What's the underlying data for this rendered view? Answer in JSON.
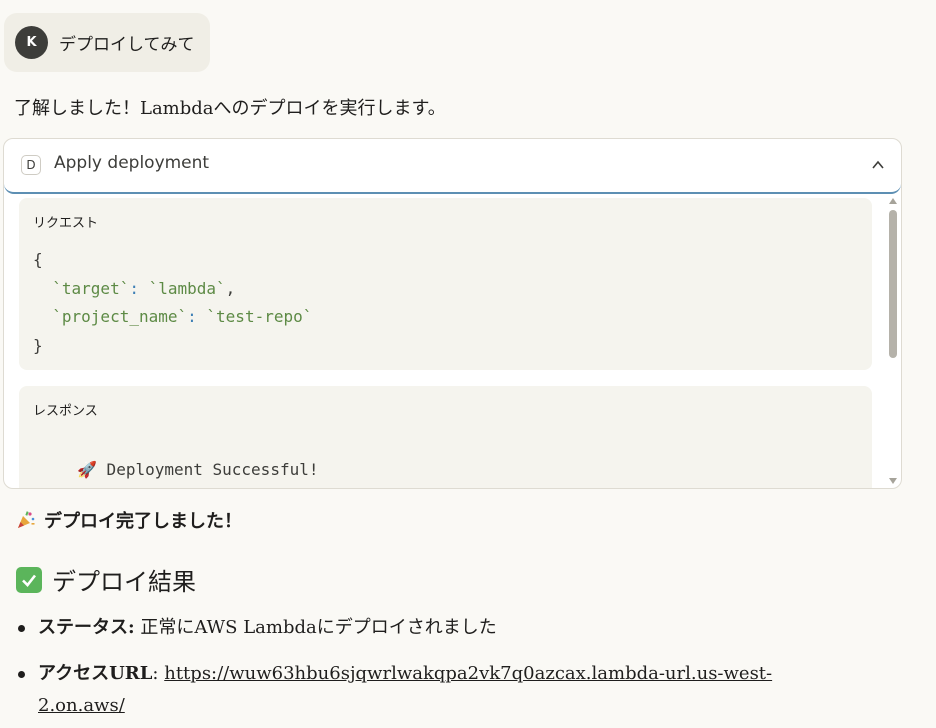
{
  "user_message": {
    "avatar_initial": "K",
    "text": "デプロイしてみて"
  },
  "assistant": {
    "intro": "了解しました！Lambdaへのデプロイを実行します。",
    "tool_call": {
      "icon_letter": "D",
      "title": "Apply deployment",
      "request_label": "リクエスト",
      "request_code": {
        "open": "{",
        "line1_key": "`target`",
        "line1_colon": ":",
        "line1_value": "`lambda`",
        "line1_comma": ",",
        "line2_key": "`project_name`",
        "line2_colon": ":",
        "line2_value": "`test-repo`",
        "close": "}"
      },
      "response_label": "レスポンス",
      "response_text": "🚀 Deployment Successful!"
    },
    "done_text": "デプロイ完了しました！",
    "result_heading": "デプロイ結果",
    "results": [
      {
        "key": "ステータス",
        "sep": ":",
        "value": " 正常にAWS Lambdaにデプロイされました"
      },
      {
        "key": "アクセスURL",
        "sep": ":",
        "url_line1": "https://wuw63hbu6sjqwrlwakqpa2vk7q0azcax.lambda-url.us-west-",
        "url_line2": "2.on.aws/"
      }
    ]
  },
  "colors": {
    "background": "#faf9f5",
    "bubble": "#f0eee6",
    "accent_border": "#5d8fb3",
    "code_string": "#5d8a45",
    "code_punct": "#3d7fb5",
    "check_green": "#5bb55b"
  },
  "icons": [
    "party-popper-icon",
    "chevron-up-icon",
    "check-mark-button-icon",
    "rocket-icon"
  ]
}
